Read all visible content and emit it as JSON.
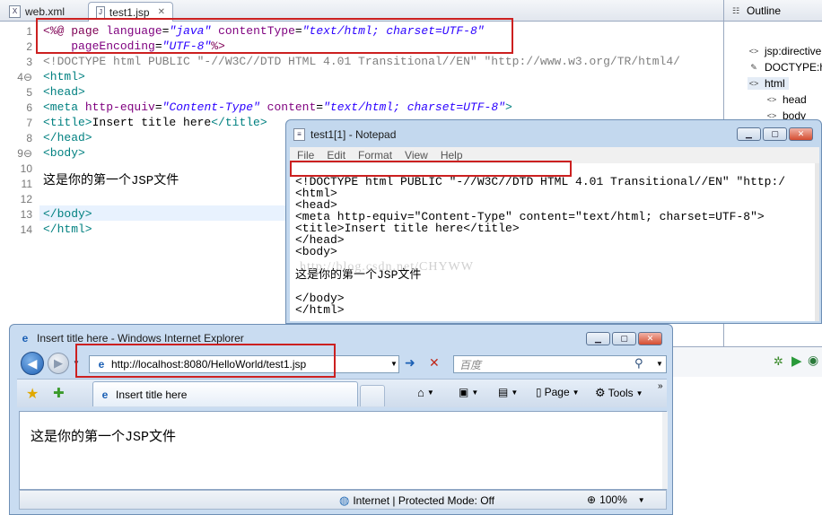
{
  "eclipse": {
    "tabs": [
      {
        "label": "web.xml",
        "icon": "xml-file-icon"
      },
      {
        "label": "test1.jsp",
        "icon": "jsp-file-icon",
        "close": "✕"
      }
    ],
    "line_numbers": [
      "1",
      "2",
      "3",
      "4⊖",
      "5",
      "6",
      "7",
      "8",
      "9⊖",
      "10",
      "11",
      "12",
      "13",
      "14"
    ],
    "code": {
      "l1": {
        "a": "<%@ ",
        "b": "page ",
        "c": "language",
        "d": "=",
        "e": "\"java\"",
        "f": " contentType",
        "g": "=",
        "h": "\"text/html; charset=UTF-8\""
      },
      "l2": {
        "a": "    pageEncoding",
        "b": "=",
        "c": "\"UTF-8\"",
        "d": "%>"
      },
      "l3": {
        "a": "<!DOCTYPE html PUBLIC \"-//W3C//DTD HTML 4.01 Transitional//EN\" \"http://www.w3.org/TR/html4/"
      },
      "l4": "<html>",
      "l5": "<head>",
      "l6": {
        "a": "<meta ",
        "b": "http-equiv",
        "c": "=",
        "d": "\"Content-Type\"",
        "e": " content",
        "f": "=",
        "g": "\"text/html; charset=UTF-8\"",
        "h": ">"
      },
      "l7": {
        "a": "<title>",
        "b": "Insert title here",
        "c": "</title>"
      },
      "l8": "</head>",
      "l9": "<body>",
      "l11": "这是你的第一个JSP文件",
      "l13": "</body>",
      "l14": "</html>"
    }
  },
  "outline": {
    "title": "Outline",
    "items": [
      {
        "label": "jsp:directive",
        "icon": "directive-icon"
      },
      {
        "label": "DOCTYPE:h",
        "icon": "doctype-icon"
      },
      {
        "label": "html",
        "icon": "html-element-icon"
      },
      {
        "label": "head",
        "icon": "element-icon"
      },
      {
        "label": "body",
        "icon": "element-icon"
      }
    ]
  },
  "notepad": {
    "title": "test1[1] - Notepad",
    "menu": [
      "File",
      "Edit",
      "Format",
      "View",
      "Help"
    ],
    "lines": [
      "<!DOCTYPE html PUBLIC \"-//W3C//DTD HTML 4.01 Transitional//EN\" \"http:/",
      "<html>",
      "<head>",
      "<meta http-equiv=\"Content-Type\" content=\"text/html; charset=UTF-8\">",
      "<title>Insert title here</title>",
      "</head>",
      "<body>",
      "这是你的第一个JSP文件",
      "</body>",
      "</html>"
    ],
    "watermark": "http://blog.csdn.net/CHYWW"
  },
  "ie": {
    "title": "Insert title here - Windows Internet Explorer",
    "address": "http://localhost:8080/HelloWorld/test1.jsp",
    "search_placeholder": "百度",
    "tab_label": "Insert title here",
    "page_label": "Page",
    "tools_label": "Tools",
    "content_text": "这是你的第一个JSP文件",
    "status_zone": "Internet | Protected Mode: Off",
    "zoom": "100%"
  },
  "colors": {
    "highlight_box": "#cc2020",
    "jsp_keyword": "#7f0055",
    "string": "#2a00ff",
    "tag": "#008080"
  }
}
